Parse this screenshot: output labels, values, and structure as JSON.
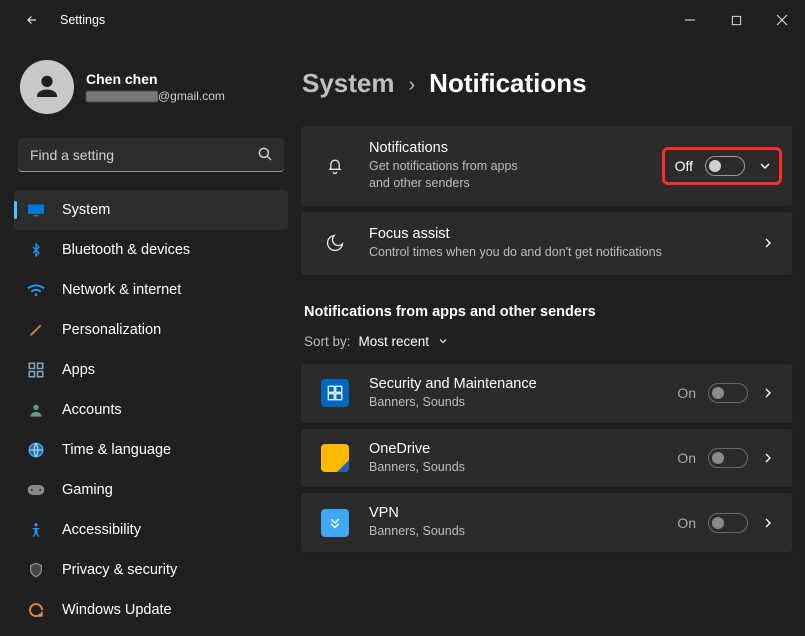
{
  "titlebar": {
    "app_title": "Settings"
  },
  "profile": {
    "name": "Chen chen",
    "email_suffix": "@gmail.com"
  },
  "search": {
    "placeholder": "Find a setting"
  },
  "nav": {
    "items": [
      {
        "id": "system",
        "label": "System",
        "icon": "system-icon",
        "selected": true
      },
      {
        "id": "bluetooth",
        "label": "Bluetooth & devices",
        "icon": "bluetooth-icon"
      },
      {
        "id": "network",
        "label": "Network & internet",
        "icon": "wifi-icon"
      },
      {
        "id": "personalization",
        "label": "Personalization",
        "icon": "paint-icon"
      },
      {
        "id": "apps",
        "label": "Apps",
        "icon": "apps-icon"
      },
      {
        "id": "accounts",
        "label": "Accounts",
        "icon": "person-icon"
      },
      {
        "id": "time",
        "label": "Time & language",
        "icon": "globe-icon"
      },
      {
        "id": "gaming",
        "label": "Gaming",
        "icon": "gamepad-icon"
      },
      {
        "id": "accessibility",
        "label": "Accessibility",
        "icon": "accessibility-icon"
      },
      {
        "id": "privacy",
        "label": "Privacy & security",
        "icon": "shield-icon"
      },
      {
        "id": "update",
        "label": "Windows Update",
        "icon": "update-icon"
      }
    ]
  },
  "breadcrumb": {
    "parent": "System",
    "current": "Notifications"
  },
  "cards": {
    "notifications": {
      "title": "Notifications",
      "sub": "Get notifications from apps and other senders",
      "state": "Off"
    },
    "focus": {
      "title": "Focus assist",
      "sub": "Control times when you do and don't get notifications"
    }
  },
  "apps_section": {
    "title": "Notifications from apps and other senders",
    "sort_label": "Sort by:",
    "sort_value": "Most recent",
    "items": [
      {
        "title": "Security and Maintenance",
        "sub": "Banners, Sounds",
        "state": "On",
        "tile": "blue"
      },
      {
        "title": "OneDrive",
        "sub": "Banners, Sounds",
        "state": "On",
        "tile": "yellow"
      },
      {
        "title": "VPN",
        "sub": "Banners, Sounds",
        "state": "On",
        "tile": "lightblue"
      }
    ]
  }
}
